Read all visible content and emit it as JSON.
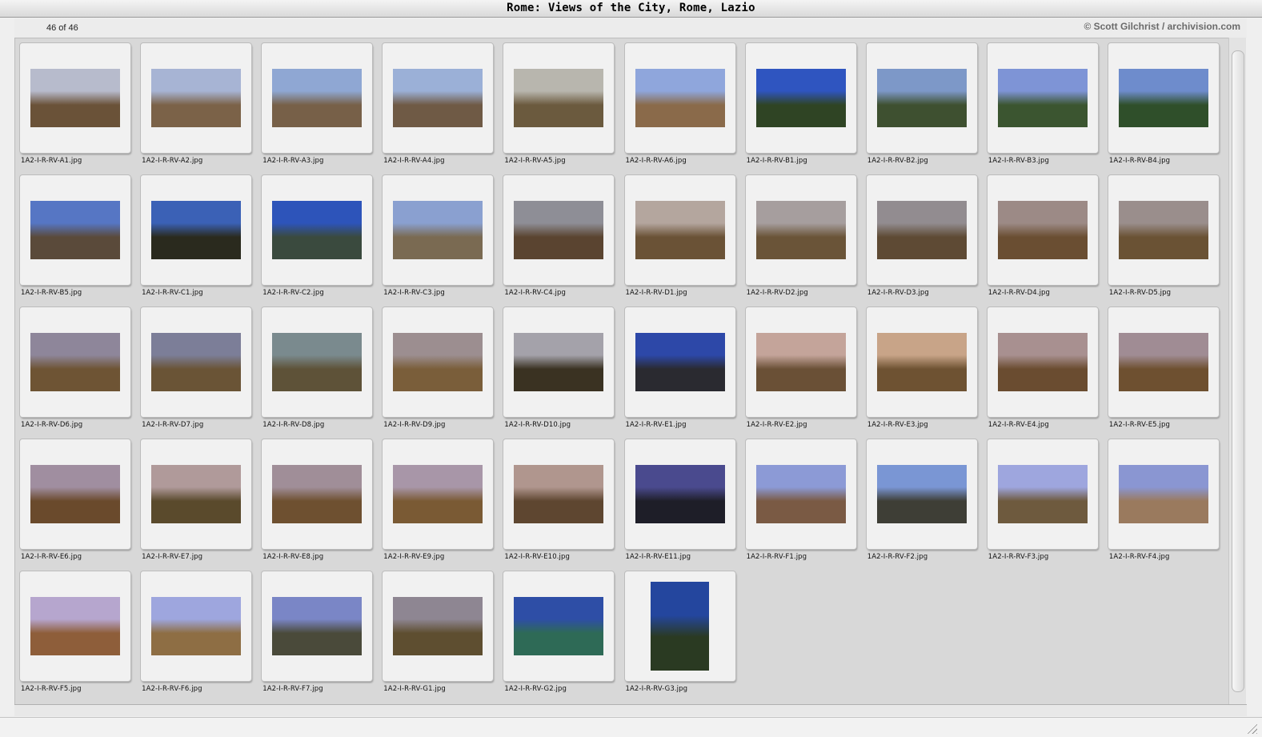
{
  "window": {
    "title": "Rome: Views of the City, Rome, Lazio"
  },
  "header": {
    "count": "46 of 46",
    "credit": "© Scott Gilchrist / archivision.com"
  },
  "thumbnails": [
    {
      "filename": "1A2-I-R-RV-A1.jpg",
      "orientation": "landscape",
      "sky": "#b7bbcc",
      "ground": "#6a5238"
    },
    {
      "filename": "1A2-I-R-RV-A2.jpg",
      "orientation": "landscape",
      "sky": "#a7b4d4",
      "ground": "#7b6248"
    },
    {
      "filename": "1A2-I-R-RV-A3.jpg",
      "orientation": "landscape",
      "sky": "#8fa7d3",
      "ground": "#776048"
    },
    {
      "filename": "1A2-I-R-RV-A4.jpg",
      "orientation": "landscape",
      "sky": "#9bb0d7",
      "ground": "#6f5a45"
    },
    {
      "filename": "1A2-I-R-RV-A5.jpg",
      "orientation": "landscape",
      "sky": "#b8b6ae",
      "ground": "#6b5a3e"
    },
    {
      "filename": "1A2-I-R-RV-A6.jpg",
      "orientation": "landscape",
      "sky": "#8fa6dc",
      "ground": "#8a6a4a"
    },
    {
      "filename": "1A2-I-R-RV-B1.jpg",
      "orientation": "landscape",
      "sky": "#2f55c0",
      "ground": "#2f4424"
    },
    {
      "filename": "1A2-I-R-RV-B2.jpg",
      "orientation": "landscape",
      "sky": "#7d98c8",
      "ground": "#3e5030"
    },
    {
      "filename": "1A2-I-R-RV-B3.jpg",
      "orientation": "landscape",
      "sky": "#7e94d6",
      "ground": "#3b5530"
    },
    {
      "filename": "1A2-I-R-RV-B4.jpg",
      "orientation": "landscape",
      "sky": "#6e8ccc",
      "ground": "#2f4f2a"
    },
    {
      "filename": "1A2-I-R-RV-B5.jpg",
      "orientation": "landscape",
      "sky": "#5676c4",
      "ground": "#5a4a3a"
    },
    {
      "filename": "1A2-I-R-RV-C1.jpg",
      "orientation": "landscape",
      "sky": "#3b61b6",
      "ground": "#2a2a1e"
    },
    {
      "filename": "1A2-I-R-RV-C2.jpg",
      "orientation": "landscape",
      "sky": "#2d54ba",
      "ground": "#3a4a3e"
    },
    {
      "filename": "1A2-I-R-RV-C3.jpg",
      "orientation": "landscape",
      "sky": "#8aa0d0",
      "ground": "#7a6a52"
    },
    {
      "filename": "1A2-I-R-RV-C4.jpg",
      "orientation": "landscape",
      "sky": "#8e8e96",
      "ground": "#5a4430"
    },
    {
      "filename": "1A2-I-R-RV-D1.jpg",
      "orientation": "landscape",
      "sky": "#b4a69e",
      "ground": "#6a5236"
    },
    {
      "filename": "1A2-I-R-RV-D2.jpg",
      "orientation": "landscape",
      "sky": "#a69e9e",
      "ground": "#6a5438"
    },
    {
      "filename": "1A2-I-R-RV-D3.jpg",
      "orientation": "landscape",
      "sky": "#928c90",
      "ground": "#5e4a34"
    },
    {
      "filename": "1A2-I-R-RV-D4.jpg",
      "orientation": "landscape",
      "sky": "#9c8a86",
      "ground": "#6a4e32"
    },
    {
      "filename": "1A2-I-R-RV-D5.jpg",
      "orientation": "landscape",
      "sky": "#9a8e8c",
      "ground": "#6a5234"
    },
    {
      "filename": "1A2-I-R-RV-D6.jpg",
      "orientation": "landscape",
      "sky": "#8e869a",
      "ground": "#6e5434"
    },
    {
      "filename": "1A2-I-R-RV-D7.jpg",
      "orientation": "landscape",
      "sky": "#7c7e98",
      "ground": "#6a5436"
    },
    {
      "filename": "1A2-I-R-RV-D8.jpg",
      "orientation": "landscape",
      "sky": "#7a8a8e",
      "ground": "#5e5238"
    },
    {
      "filename": "1A2-I-R-RV-D9.jpg",
      "orientation": "landscape",
      "sky": "#9c8e90",
      "ground": "#7a5e3a"
    },
    {
      "filename": "1A2-I-R-RV-D10.jpg",
      "orientation": "landscape",
      "sky": "#a4a2aa",
      "ground": "#3a3222"
    },
    {
      "filename": "1A2-I-R-RV-E1.jpg",
      "orientation": "landscape",
      "sky": "#2d48a8",
      "ground": "#2a2a30"
    },
    {
      "filename": "1A2-I-R-RV-E2.jpg",
      "orientation": "landscape",
      "sky": "#c4a49a",
      "ground": "#6a5036"
    },
    {
      "filename": "1A2-I-R-RV-E3.jpg",
      "orientation": "landscape",
      "sky": "#c8a488",
      "ground": "#6e5232"
    },
    {
      "filename": "1A2-I-R-RV-E4.jpg",
      "orientation": "landscape",
      "sky": "#a89090",
      "ground": "#6a4c30"
    },
    {
      "filename": "1A2-I-R-RV-E5.jpg",
      "orientation": "landscape",
      "sky": "#a08c94",
      "ground": "#6e5030"
    },
    {
      "filename": "1A2-I-R-RV-E6.jpg",
      "orientation": "landscape",
      "sky": "#a08ea0",
      "ground": "#6a4a2c"
    },
    {
      "filename": "1A2-I-R-RV-E7.jpg",
      "orientation": "landscape",
      "sky": "#b09a9a",
      "ground": "#5a4a2c"
    },
    {
      "filename": "1A2-I-R-RV-E8.jpg",
      "orientation": "landscape",
      "sky": "#a08e98",
      "ground": "#6e5030"
    },
    {
      "filename": "1A2-I-R-RV-E9.jpg",
      "orientation": "landscape",
      "sky": "#a896a8",
      "ground": "#7a5a34"
    },
    {
      "filename": "1A2-I-R-RV-E10.jpg",
      "orientation": "landscape",
      "sky": "#b0968e",
      "ground": "#5e4630"
    },
    {
      "filename": "1A2-I-R-RV-E11.jpg",
      "orientation": "landscape",
      "sky": "#4a4a8e",
      "ground": "#1e1e28"
    },
    {
      "filename": "1A2-I-R-RV-F1.jpg",
      "orientation": "landscape",
      "sky": "#8c9ad6",
      "ground": "#7a5a44"
    },
    {
      "filename": "1A2-I-R-RV-F2.jpg",
      "orientation": "landscape",
      "sky": "#7a96d4",
      "ground": "#3e3e36"
    },
    {
      "filename": "1A2-I-R-RV-F3.jpg",
      "orientation": "landscape",
      "sky": "#9ea6de",
      "ground": "#6e5a3e"
    },
    {
      "filename": "1A2-I-R-RV-F4.jpg",
      "orientation": "landscape",
      "sky": "#8a96d2",
      "ground": "#9a7a5e"
    },
    {
      "filename": "1A2-I-R-RV-F5.jpg",
      "orientation": "landscape",
      "sky": "#b6a6ce",
      "ground": "#8e5e3a"
    },
    {
      "filename": "1A2-I-R-RV-F6.jpg",
      "orientation": "landscape",
      "sky": "#9ea6de",
      "ground": "#8e6e44"
    },
    {
      "filename": "1A2-I-R-RV-F7.jpg",
      "orientation": "landscape",
      "sky": "#7a86c6",
      "ground": "#4a4a3a"
    },
    {
      "filename": "1A2-I-R-RV-G1.jpg",
      "orientation": "landscape",
      "sky": "#8e8692",
      "ground": "#5e4e30"
    },
    {
      "filename": "1A2-I-R-RV-G2.jpg",
      "orientation": "landscape",
      "sky": "#2e4ea6",
      "ground": "#2e6a56"
    },
    {
      "filename": "1A2-I-R-RV-G3.jpg",
      "orientation": "portrait",
      "sky": "#24469e",
      "ground": "#2a3a22"
    }
  ]
}
